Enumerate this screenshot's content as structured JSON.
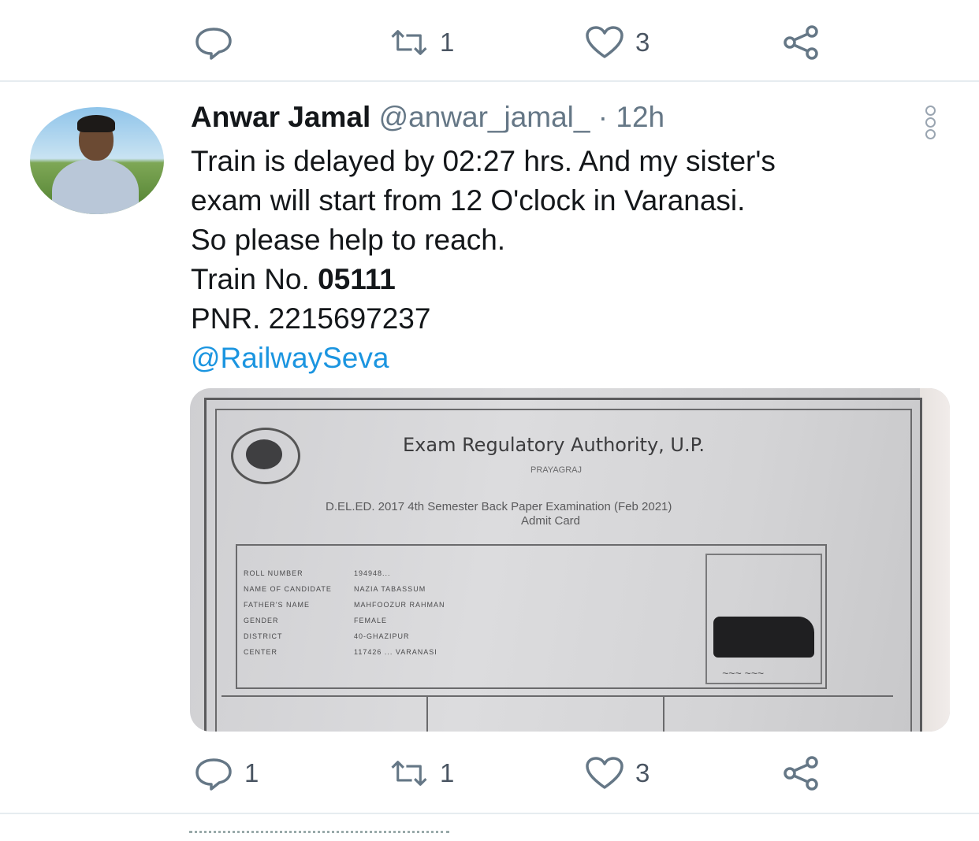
{
  "prev_actions": {
    "reply": {
      "icon": "reply-icon",
      "count": ""
    },
    "retweet": {
      "icon": "retweet-icon",
      "count": "1"
    },
    "like": {
      "icon": "heart-icon",
      "count": "3"
    },
    "share": {
      "icon": "share-icon"
    }
  },
  "tweet": {
    "name": "Anwar Jamal",
    "handle": "@anwar_jamal_",
    "separator": "·",
    "time": "12h",
    "lines": [
      "Train is delayed by 02:27 hrs. And my sister's",
      "exam will start from 12 O'clock in Varanasi.",
      "So please help to reach."
    ],
    "train_prefix": "Train No.",
    "train_no": "05111",
    "pnr": "PNR. 2215697237",
    "mention": "@RailwaySeva",
    "media": {
      "title": "Exam Regulatory Authority, U.P.",
      "subtitle": "PRAYAGRAJ",
      "line1": "D.EL.ED. 2017 4th Semester Back Paper Examination (Feb 2021)",
      "line2": "Admit Card",
      "rows": [
        {
          "label": "ROLL NUMBER",
          "value": "194948..."
        },
        {
          "label": "NAME OF CANDIDATE",
          "value": "NAZIA TABASSUM"
        },
        {
          "label": "FATHER'S NAME",
          "value": "MAHFOOZUR RAHMAN"
        },
        {
          "label": "GENDER",
          "value": "FEMALE"
        },
        {
          "label": "DISTRICT",
          "value": "40-GHAZIPUR"
        },
        {
          "label": "CENTER",
          "value": "117426 ... VARANASI"
        }
      ]
    },
    "actions": {
      "reply": {
        "icon": "reply-icon",
        "count": "1"
      },
      "retweet": {
        "icon": "retweet-icon",
        "count": "1"
      },
      "like": {
        "icon": "heart-icon",
        "count": "3"
      },
      "share": {
        "icon": "share-icon"
      }
    }
  },
  "colors": {
    "link": "#1b95e0",
    "muted": "#657786",
    "divider": "#e6ecf0"
  }
}
